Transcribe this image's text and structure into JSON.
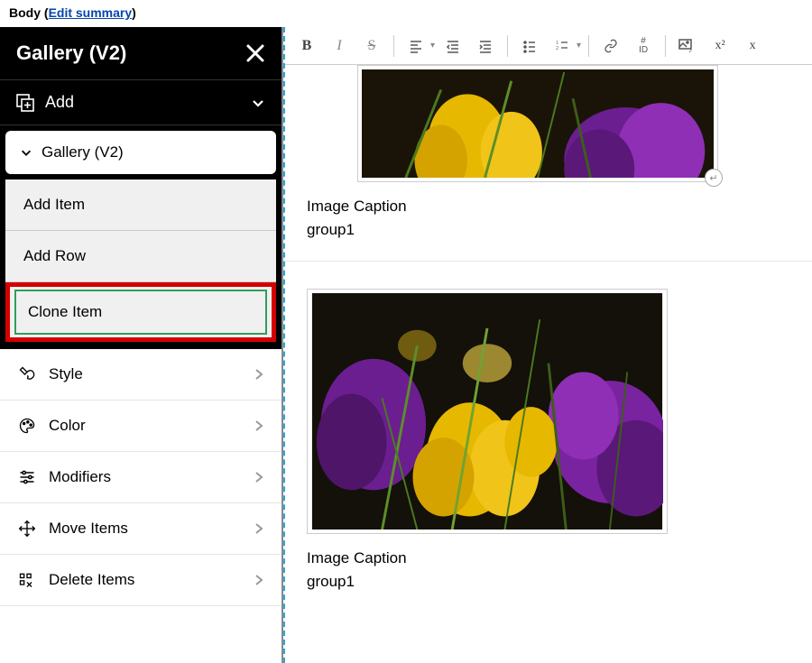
{
  "header": {
    "body_label": "Body",
    "edit_summary_link": "Edit summary"
  },
  "sidebar": {
    "panel_title": "Gallery (V2)",
    "add_label": "Add",
    "section_label": "Gallery (V2)",
    "actions": {
      "add_item": "Add Item",
      "add_row": "Add Row",
      "clone_item": "Clone Item"
    },
    "options": {
      "style": "Style",
      "color": "Color",
      "modifiers": "Modifiers",
      "move_items": "Move Items",
      "delete_items": "Delete Items"
    }
  },
  "toolbar": {
    "bold": "B",
    "italic": "I",
    "strike": "S",
    "id_label": "#\nID",
    "sup": "x²",
    "sub": "x"
  },
  "content": {
    "items": [
      {
        "caption": "Image Caption",
        "group": "group1"
      },
      {
        "caption": "Image Caption",
        "group": "group1"
      }
    ]
  }
}
